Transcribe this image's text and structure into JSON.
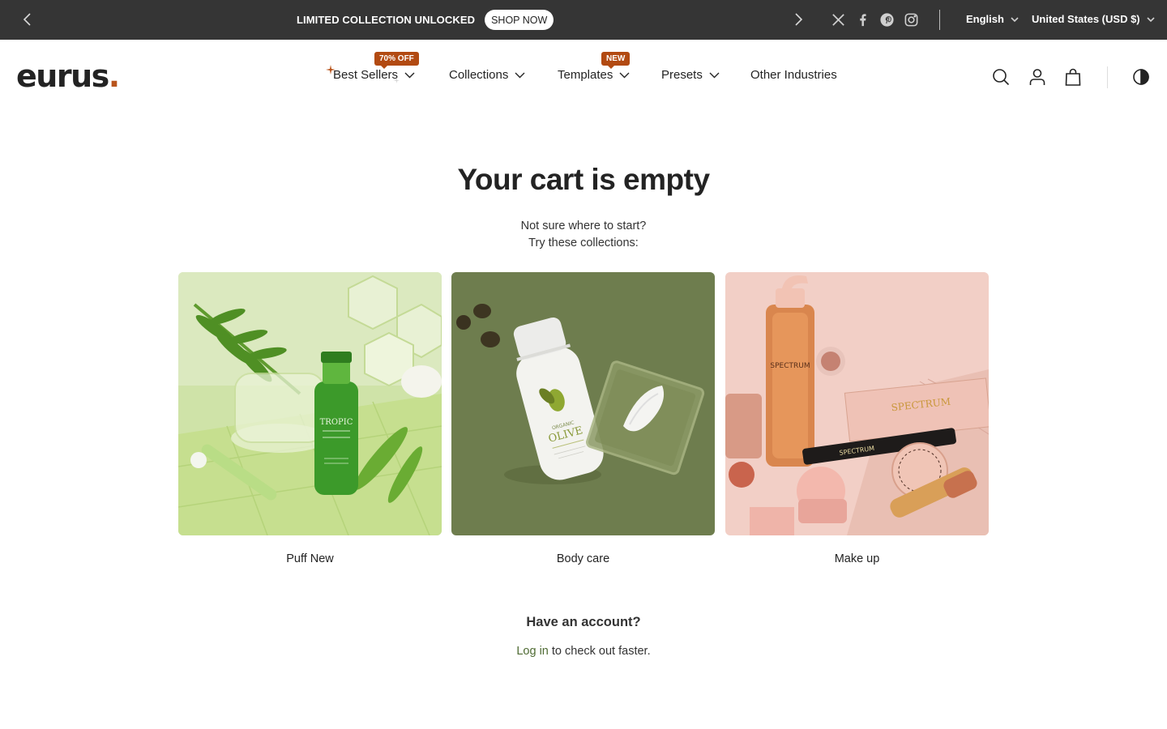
{
  "announcement": {
    "text": "LIMITED COLLECTION UNLOCKED",
    "button": "SHOP NOW"
  },
  "topbar": {
    "language": "English",
    "currency": "United States (USD $)",
    "social_icons": [
      "x-icon",
      "facebook-icon",
      "pinterest-icon",
      "instagram-icon"
    ]
  },
  "logo": {
    "text": "eurus",
    "dot": "."
  },
  "nav": {
    "best_sellers": "Best Sellers",
    "best_sellers_badge": "70% OFF",
    "collections": "Collections",
    "templates": "Templates",
    "templates_badge": "NEW",
    "presets": "Presets",
    "other_industries": "Other Industries"
  },
  "header_icons": [
    "search-icon",
    "account-icon",
    "cart-icon",
    "theme-toggle-icon"
  ],
  "cart": {
    "title": "Your cart is empty",
    "line1": "Not sure where to start?",
    "line2": "Try these collections:"
  },
  "collections": [
    {
      "label": "Puff New"
    },
    {
      "label": "Body care"
    },
    {
      "label": "Make up"
    }
  ],
  "account": {
    "title": "Have an account?",
    "login_link": "Log in",
    "login_suffix": " to check out faster."
  },
  "colors": {
    "topbar_bg": "#353535",
    "accent_badge": "#b24a12",
    "logo_dot": "#b8541c",
    "login_link": "#4f6b33"
  }
}
